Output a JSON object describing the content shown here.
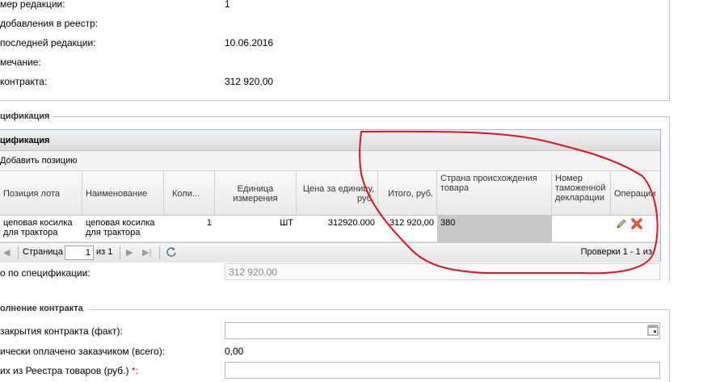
{
  "info": {
    "rows": [
      {
        "label": "мер редакции:",
        "value": "1"
      },
      {
        "label": "добавления в реестр:",
        "value": ""
      },
      {
        "label": "последней редакции:",
        "value": "10.06.2016"
      },
      {
        "label": "мечание:",
        "value": ""
      },
      {
        "label": "контракта:",
        "value": "312 920,00"
      }
    ]
  },
  "spec_legend": "цификация",
  "grid": {
    "title": "цификация",
    "add_button": "Добавить позицию",
    "columns": [
      "Позиция лота",
      "Наименование",
      "Коли...",
      "Единица измерения",
      "Цена за единицу, руб.",
      "Итого, руб.",
      "Страна происхождения товара",
      "Номер таможенной декларации",
      "Операции"
    ],
    "row": {
      "lot": "цеповая косилка для трактора",
      "name": "цеповая косилка для трактора",
      "qty": "1",
      "unit": "ШТ",
      "price": "312920.000",
      "total": "312 920,00",
      "country": "380",
      "declaration": ""
    },
    "pager": {
      "page_label": "Страница",
      "page_value": "1",
      "of_label": "из 1",
      "checks": "Проверки 1 - 1 из"
    }
  },
  "spec_total": {
    "label": "о по спецификации:",
    "value": "312 920,00"
  },
  "exec_legend": "олнение контракта",
  "exec": {
    "rows": [
      {
        "label": "закрытия контракта (факт):"
      },
      {
        "label": "ически оплачено заказчиком (всего):",
        "value": "0,00"
      },
      {
        "label": "их из Реестра товаров (руб.)",
        "required": "*:"
      }
    ]
  },
  "colors": {
    "annotation": "#e0141e",
    "grid_border": "#99bbe8"
  }
}
